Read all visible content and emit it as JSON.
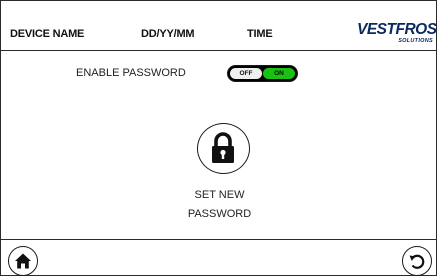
{
  "header": {
    "device_name": "DEVICE NAME",
    "date_format": "DD/YY/MM",
    "time": "TIME",
    "brand": {
      "name": "VESTFROST",
      "subtitle": "SOLUTIONS",
      "color": "#0d2a60"
    }
  },
  "password": {
    "label": "ENABLE PASSWORD",
    "toggle": {
      "off_label": "OFF",
      "on_label": "ON",
      "state": "ON",
      "on_color": "#19c212"
    }
  },
  "set_password": {
    "icon": "lock-icon",
    "line1": "SET NEW",
    "line2": "PASSWORD"
  },
  "footer": {
    "home_icon": "home-icon",
    "back_icon": "back-icon"
  }
}
